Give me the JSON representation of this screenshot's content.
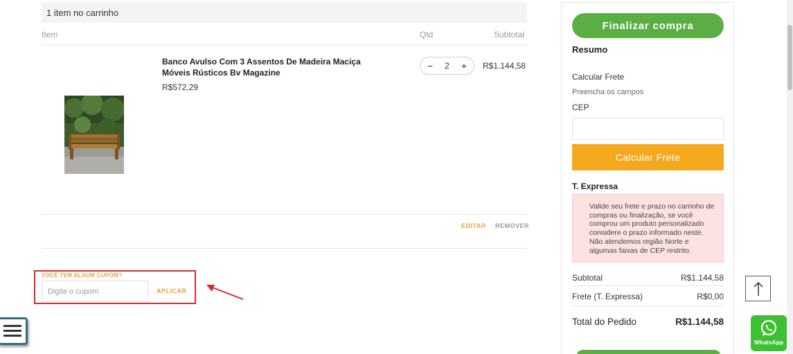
{
  "cart": {
    "count_label": "1 item no carrinho",
    "col_item": "Item",
    "col_qtd": "Qtd",
    "col_subtotal": "Subtotal"
  },
  "product": {
    "name": "Banco Avulso Com 3 Assentos De Madeira Maciça Móveis Rústicos Bv Magazine",
    "unit_price": "R$572,29",
    "quantity": "2",
    "minus": "−",
    "plus": "+",
    "subtotal": "R$1.144,58",
    "edit_label": "EDITAR",
    "remove_label": "REMOVER"
  },
  "coupon": {
    "label": "VOCÊ TEM ALGUM CUPOM?",
    "placeholder": "Digite o cupom",
    "apply_label": "APLICAR"
  },
  "summary": {
    "checkout_label": "Finalizar compra",
    "title": "Resumo",
    "calc_title": "Calcular Frete",
    "calc_hint": "Preencha os campos",
    "cep_label": "CEP",
    "calc_button": "Calcular Frete",
    "shipping_method": "T. Expressa",
    "notice": "Valide seu frete e prazo no carrinho de compras ou finalização, se você comprou um produto personalizado considere o prazo informado neste. Não atendemos região Norte e algumas faixas de CEP restrito.",
    "subtotal_label": "Subtotal",
    "subtotal_value": "R$1.144,58",
    "freight_label": "Frete (T. Expressa)",
    "freight_value": "R$0,00",
    "total_label": "Total do Pedido",
    "total_value": "R$1.144,58"
  },
  "widgets": {
    "whatsapp_label": "WhatsApp",
    "icons": [
      "menu-icon",
      "arrow-up-icon",
      "whatsapp-icon",
      "annotation-arrow-icon"
    ]
  },
  "colors": {
    "accent_orange": "#e8a23a",
    "checkout_green": "#5aae43",
    "calc_orange": "#f4a81d",
    "notice_pink": "#fde2e2",
    "highlight_red": "#d9282f"
  }
}
